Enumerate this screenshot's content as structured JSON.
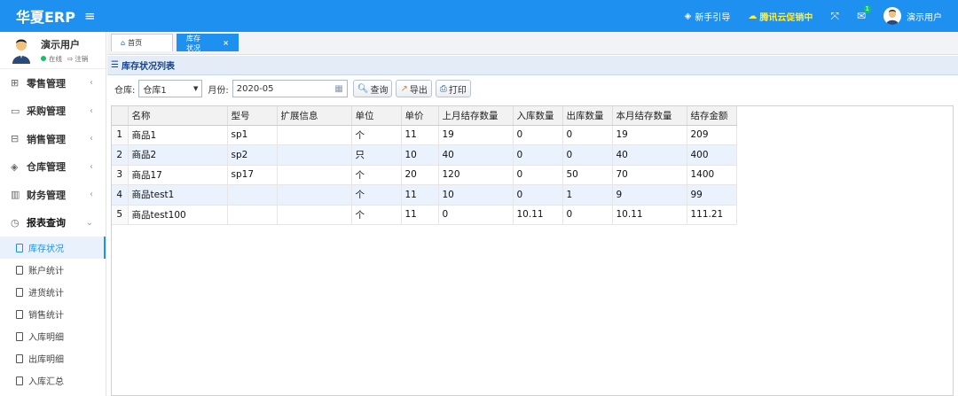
{
  "app": {
    "brand": "华夏ERP",
    "menu_icon": "hamburger-icon"
  },
  "topbar": {
    "guide": "新手引导",
    "promo": "腾讯云促销中",
    "mail_badge": "1",
    "user": "演示用户"
  },
  "user": {
    "name": "演示用户",
    "status": "在线",
    "logout": "注销"
  },
  "sidebar": {
    "menus": [
      {
        "label": "零售管理",
        "icon": "gift-icon"
      },
      {
        "label": "采购管理",
        "icon": "monitor-icon"
      },
      {
        "label": "销售管理",
        "icon": "briefcase-icon"
      },
      {
        "label": "仓库管理",
        "icon": "layers-icon"
      },
      {
        "label": "财务管理",
        "icon": "book-icon"
      },
      {
        "label": "报表查询",
        "icon": "clock-icon"
      }
    ],
    "sub_items": [
      "库存状况",
      "账户统计",
      "进货统计",
      "销售统计",
      "入库明细",
      "出库明细",
      "入库汇总"
    ]
  },
  "tabs": {
    "home": "首页",
    "current": "库存状况",
    "close": "×"
  },
  "panel": {
    "title": "库存状况列表"
  },
  "toolbar": {
    "warehouse_label": "仓库:",
    "warehouse_value": "仓库1",
    "month_label": "月份:",
    "month_value": "2020-05",
    "query": "查询",
    "export": "导出",
    "print": "打印"
  },
  "table": {
    "columns": [
      "名称",
      "型号",
      "扩展信息",
      "单位",
      "单价",
      "上月结存数量",
      "入库数量",
      "出库数量",
      "本月结存数量",
      "结存金额"
    ],
    "rows": [
      [
        "1",
        "商品1",
        "sp1",
        "",
        "个",
        "11",
        "19",
        "0",
        "0",
        "19",
        "209"
      ],
      [
        "2",
        "商品2",
        "sp2",
        "",
        "只",
        "10",
        "40",
        "0",
        "0",
        "40",
        "400"
      ],
      [
        "3",
        "商品17",
        "sp17",
        "",
        "个",
        "20",
        "120",
        "0",
        "50",
        "70",
        "1400"
      ],
      [
        "4",
        "商品test1",
        "",
        "",
        "个",
        "11",
        "10",
        "0",
        "1",
        "9",
        "99"
      ],
      [
        "5",
        "商品test100",
        "",
        "",
        "个",
        "11",
        "0",
        "10.11",
        "0",
        "10.11",
        "111.21"
      ]
    ]
  },
  "colors": {
    "primary": "#1e90ef",
    "promo": "#ffec3d",
    "online": "#19be6b"
  }
}
